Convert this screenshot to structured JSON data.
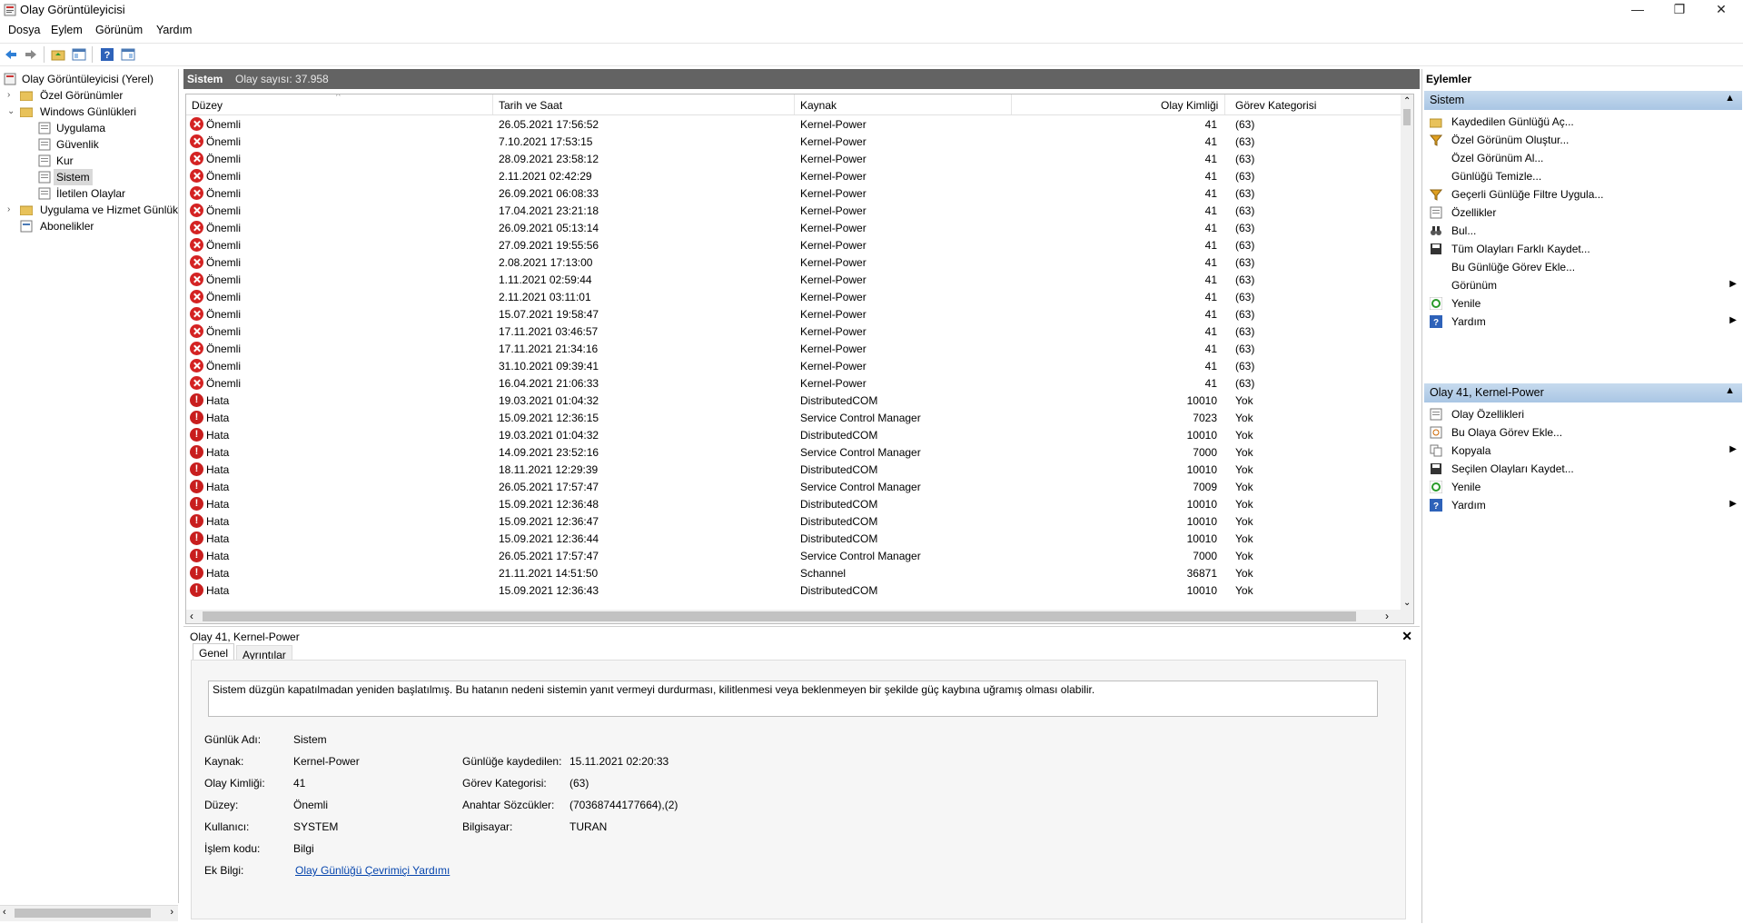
{
  "window": {
    "title": "Olay Görüntüleyicisi",
    "minimize": "—",
    "restore": "❐",
    "close": "✕"
  },
  "menu": [
    "Dosya",
    "Eylem",
    "Görünüm",
    "Yardım"
  ],
  "tree": {
    "root": "Olay Görüntüleyicisi (Yerel)",
    "custom_views": "Özel Görünümler",
    "windows_logs": "Windows Günlükleri",
    "logs": [
      "Uygulama",
      "Güvenlik",
      "Kur",
      "Sistem",
      "İletilen Olaylar"
    ],
    "app_services": "Uygulama ve Hizmet Günlükl",
    "subscriptions": "Abonelikler"
  },
  "log": {
    "name": "Sistem",
    "count_label": "Olay sayısı: 37.958"
  },
  "columns": [
    "Düzey",
    "Tarih ve Saat",
    "Kaynak",
    "Olay Kimliği",
    "Görev Kategorisi"
  ],
  "events": [
    {
      "level": "Önemli",
      "kind": "crit",
      "date": "26.05.2021 17:56:52",
      "source": "Kernel-Power",
      "id": "41",
      "cat": "(63)"
    },
    {
      "level": "Önemli",
      "kind": "crit",
      "date": "7.10.2021 17:53:15",
      "source": "Kernel-Power",
      "id": "41",
      "cat": "(63)"
    },
    {
      "level": "Önemli",
      "kind": "crit",
      "date": "28.09.2021 23:58:12",
      "source": "Kernel-Power",
      "id": "41",
      "cat": "(63)"
    },
    {
      "level": "Önemli",
      "kind": "crit",
      "date": "2.11.2021 02:42:29",
      "source": "Kernel-Power",
      "id": "41",
      "cat": "(63)"
    },
    {
      "level": "Önemli",
      "kind": "crit",
      "date": "26.09.2021 06:08:33",
      "source": "Kernel-Power",
      "id": "41",
      "cat": "(63)"
    },
    {
      "level": "Önemli",
      "kind": "crit",
      "date": "17.04.2021 23:21:18",
      "source": "Kernel-Power",
      "id": "41",
      "cat": "(63)"
    },
    {
      "level": "Önemli",
      "kind": "crit",
      "date": "26.09.2021 05:13:14",
      "source": "Kernel-Power",
      "id": "41",
      "cat": "(63)"
    },
    {
      "level": "Önemli",
      "kind": "crit",
      "date": "27.09.2021 19:55:56",
      "source": "Kernel-Power",
      "id": "41",
      "cat": "(63)"
    },
    {
      "level": "Önemli",
      "kind": "crit",
      "date": "2.08.2021 17:13:00",
      "source": "Kernel-Power",
      "id": "41",
      "cat": "(63)"
    },
    {
      "level": "Önemli",
      "kind": "crit",
      "date": "1.11.2021 02:59:44",
      "source": "Kernel-Power",
      "id": "41",
      "cat": "(63)"
    },
    {
      "level": "Önemli",
      "kind": "crit",
      "date": "2.11.2021 03:11:01",
      "source": "Kernel-Power",
      "id": "41",
      "cat": "(63)"
    },
    {
      "level": "Önemli",
      "kind": "crit",
      "date": "15.07.2021 19:58:47",
      "source": "Kernel-Power",
      "id": "41",
      "cat": "(63)"
    },
    {
      "level": "Önemli",
      "kind": "crit",
      "date": "17.11.2021 03:46:57",
      "source": "Kernel-Power",
      "id": "41",
      "cat": "(63)"
    },
    {
      "level": "Önemli",
      "kind": "crit",
      "date": "17.11.2021 21:34:16",
      "source": "Kernel-Power",
      "id": "41",
      "cat": "(63)"
    },
    {
      "level": "Önemli",
      "kind": "crit",
      "date": "31.10.2021 09:39:41",
      "source": "Kernel-Power",
      "id": "41",
      "cat": "(63)"
    },
    {
      "level": "Önemli",
      "kind": "crit",
      "date": "16.04.2021 21:06:33",
      "source": "Kernel-Power",
      "id": "41",
      "cat": "(63)"
    },
    {
      "level": "Hata",
      "kind": "err",
      "date": "19.03.2021 01:04:32",
      "source": "DistributedCOM",
      "id": "10010",
      "cat": "Yok"
    },
    {
      "level": "Hata",
      "kind": "err",
      "date": "15.09.2021 12:36:15",
      "source": "Service Control Manager",
      "id": "7023",
      "cat": "Yok"
    },
    {
      "level": "Hata",
      "kind": "err",
      "date": "19.03.2021 01:04:32",
      "source": "DistributedCOM",
      "id": "10010",
      "cat": "Yok"
    },
    {
      "level": "Hata",
      "kind": "err",
      "date": "14.09.2021 23:52:16",
      "source": "Service Control Manager",
      "id": "7000",
      "cat": "Yok"
    },
    {
      "level": "Hata",
      "kind": "err",
      "date": "18.11.2021 12:29:39",
      "source": "DistributedCOM",
      "id": "10010",
      "cat": "Yok"
    },
    {
      "level": "Hata",
      "kind": "err",
      "date": "26.05.2021 17:57:47",
      "source": "Service Control Manager",
      "id": "7009",
      "cat": "Yok"
    },
    {
      "level": "Hata",
      "kind": "err",
      "date": "15.09.2021 12:36:48",
      "source": "DistributedCOM",
      "id": "10010",
      "cat": "Yok"
    },
    {
      "level": "Hata",
      "kind": "err",
      "date": "15.09.2021 12:36:47",
      "source": "DistributedCOM",
      "id": "10010",
      "cat": "Yok"
    },
    {
      "level": "Hata",
      "kind": "err",
      "date": "15.09.2021 12:36:44",
      "source": "DistributedCOM",
      "id": "10010",
      "cat": "Yok"
    },
    {
      "level": "Hata",
      "kind": "err",
      "date": "26.05.2021 17:57:47",
      "source": "Service Control Manager",
      "id": "7000",
      "cat": "Yok"
    },
    {
      "level": "Hata",
      "kind": "err",
      "date": "21.11.2021 14:51:50",
      "source": "Schannel",
      "id": "36871",
      "cat": "Yok"
    },
    {
      "level": "Hata",
      "kind": "err",
      "date": "15.09.2021 12:36:43",
      "source": "DistributedCOM",
      "id": "10010",
      "cat": "Yok"
    }
  ],
  "detail": {
    "title": "Olay 41, Kernel-Power",
    "tabs": [
      "Genel",
      "Ayrıntılar"
    ],
    "description": "Sistem düzgün kapatılmadan yeniden başlatılmış. Bu hatanın nedeni sistemin yanıt vermeyi durdurması, kilitlenmesi veya beklenmeyen bir şekilde güç kaybına uğramış olması olabilir.",
    "labels": {
      "log_name": "Günlük Adı:",
      "source": "Kaynak:",
      "event_id": "Olay Kimliği:",
      "level": "Düzey:",
      "user": "Kullanıcı:",
      "opcode": "İşlem kodu:",
      "more_info": "Ek Bilgi:",
      "logged": "Günlüğe kaydedilen:",
      "task_category": "Görev Kategorisi:",
      "keywords": "Anahtar Sözcükler:",
      "computer": "Bilgisayar:"
    },
    "values": {
      "log_name": "Sistem",
      "source": "Kernel-Power",
      "event_id": "41",
      "level": "Önemli",
      "user": "SYSTEM",
      "opcode": "Bilgi",
      "more_info_link": "Olay Günlüğü Çevrimiçi Yardımı",
      "logged": "15.11.2021 02:20:33",
      "task_category": "(63)",
      "keywords": "(70368744177664),(2)",
      "computer": "TURAN"
    }
  },
  "actions": {
    "header": "Eylemler",
    "section1": "Sistem",
    "items1": [
      {
        "label": "Kaydedilen Günlüğü Aç...",
        "icon": "folder-open-icon",
        "arrow": false
      },
      {
        "label": "Özel Görünüm Oluştur...",
        "icon": "filter-icon",
        "arrow": false
      },
      {
        "label": "Özel Görünüm Al...",
        "icon": "none",
        "arrow": false
      },
      {
        "label": "Günlüğü Temizle...",
        "icon": "none",
        "arrow": false
      },
      {
        "label": "Geçerli Günlüğe Filtre Uygula...",
        "icon": "filter-icon",
        "arrow": false
      },
      {
        "label": "Özellikler",
        "icon": "properties-icon",
        "arrow": false
      },
      {
        "label": "Bul...",
        "icon": "binoculars-icon",
        "arrow": false
      },
      {
        "label": "Tüm Olayları Farklı Kaydet...",
        "icon": "save-icon",
        "arrow": false
      },
      {
        "label": "Bu Günlüğe Görev Ekle...",
        "icon": "none",
        "arrow": false
      },
      {
        "label": "Görünüm",
        "icon": "none",
        "arrow": true
      },
      {
        "label": "Yenile",
        "icon": "refresh-icon",
        "arrow": false
      },
      {
        "label": "Yardım",
        "icon": "help-icon",
        "arrow": true
      }
    ],
    "section2": "Olay 41, Kernel-Power",
    "items2": [
      {
        "label": "Olay Özellikleri",
        "icon": "properties-icon",
        "arrow": false
      },
      {
        "label": "Bu Olaya Görev Ekle...",
        "icon": "task-icon",
        "arrow": false
      },
      {
        "label": "Kopyala",
        "icon": "copy-icon",
        "arrow": true
      },
      {
        "label": "Seçilen Olayları Kaydet...",
        "icon": "save-icon",
        "arrow": false
      },
      {
        "label": "Yenile",
        "icon": "refresh-icon",
        "arrow": false
      },
      {
        "label": "Yardım",
        "icon": "help-icon",
        "arrow": true
      }
    ]
  }
}
